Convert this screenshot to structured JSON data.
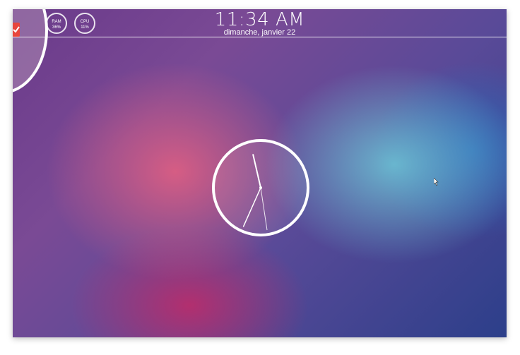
{
  "topbar": {
    "time": "11:34 AM",
    "date": "dimanche, janvier 22"
  },
  "gauges": [
    {
      "label": "RAM",
      "value": "36%"
    },
    {
      "label": "CPU",
      "value": "11%"
    }
  ],
  "launcher": {
    "icon": "checkmark-app-icon",
    "accent": "#e8453c"
  },
  "analog_clock": {
    "hour": 11,
    "minute": 34
  },
  "colors": {
    "accent": "#ffffff"
  }
}
